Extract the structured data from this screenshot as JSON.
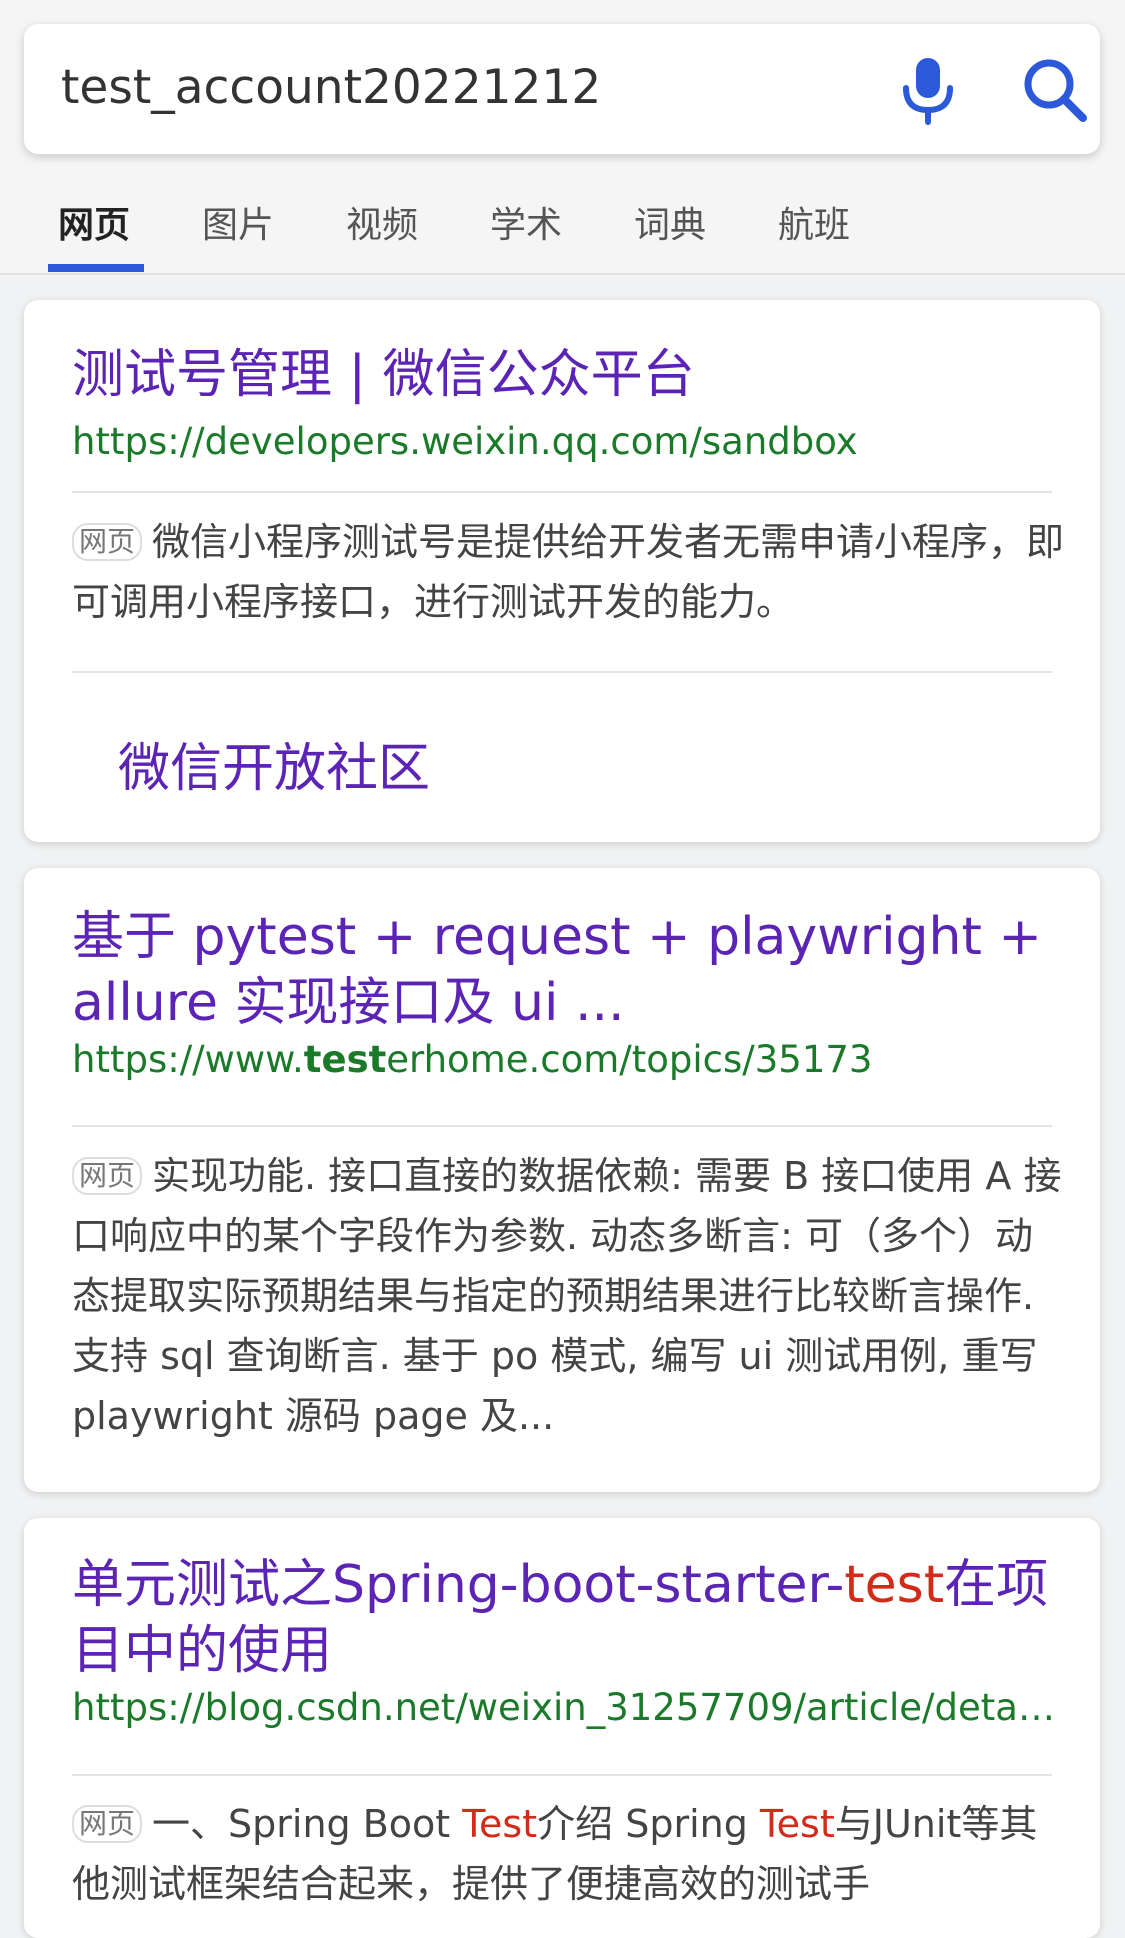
{
  "search": {
    "query": "test_account20221212"
  },
  "tabs": [
    "网页",
    "图片",
    "视频",
    "学术",
    "词典",
    "航班"
  ],
  "colors": {
    "accent": "#2b59d9",
    "link": "#5b24b5",
    "url": "#1b7a2a",
    "highlight": "#d42a1a"
  },
  "results": [
    {
      "title": "测试号管理 | 微信公众平台",
      "url": "https://developers.weixin.qq.com/sandbox",
      "badge": "网页",
      "snippet": "微信小程序测试号是提供给开发者无需申请小程序，即可调用小程序接口，进行测试开发的能力。",
      "sublink": "微信开放社区"
    },
    {
      "title_line1": "基于 pytest + request + playwright +",
      "title_line2": "allure 实现接口及 ui ...",
      "url_pre": "https://www.",
      "url_hl": "test",
      "url_post": "erhome.com/topics/35173",
      "badge": "网页",
      "snippet": "实现功能. 接口直接的数据依赖: 需要 B 接口使用 A 接口响应中的某个字段作为参数. 动态多断言: 可（多个）动态提取实际预期结果与指定的预期结果进行比较断言操作. 支持 sql 查询断言. 基于 po 模式, 编写 ui 测试用例, 重写 playwright 源码 page 及..."
    },
    {
      "title_pre": "单元测试之Spring-boot-starter-",
      "title_hl": "test",
      "title_post": "在项目中的使用",
      "url": "https://blog.csdn.net/weixin_31257709/article/deta…",
      "badge": "网页",
      "snippet_a": "一、Spring Boot ",
      "snippet_hl1": "Test",
      "snippet_b": "介绍 Spring ",
      "snippet_hl2": "Test",
      "snippet_c": "与JUnit等其他测试框架结合起来，提供了便捷高效的测试手"
    }
  ]
}
